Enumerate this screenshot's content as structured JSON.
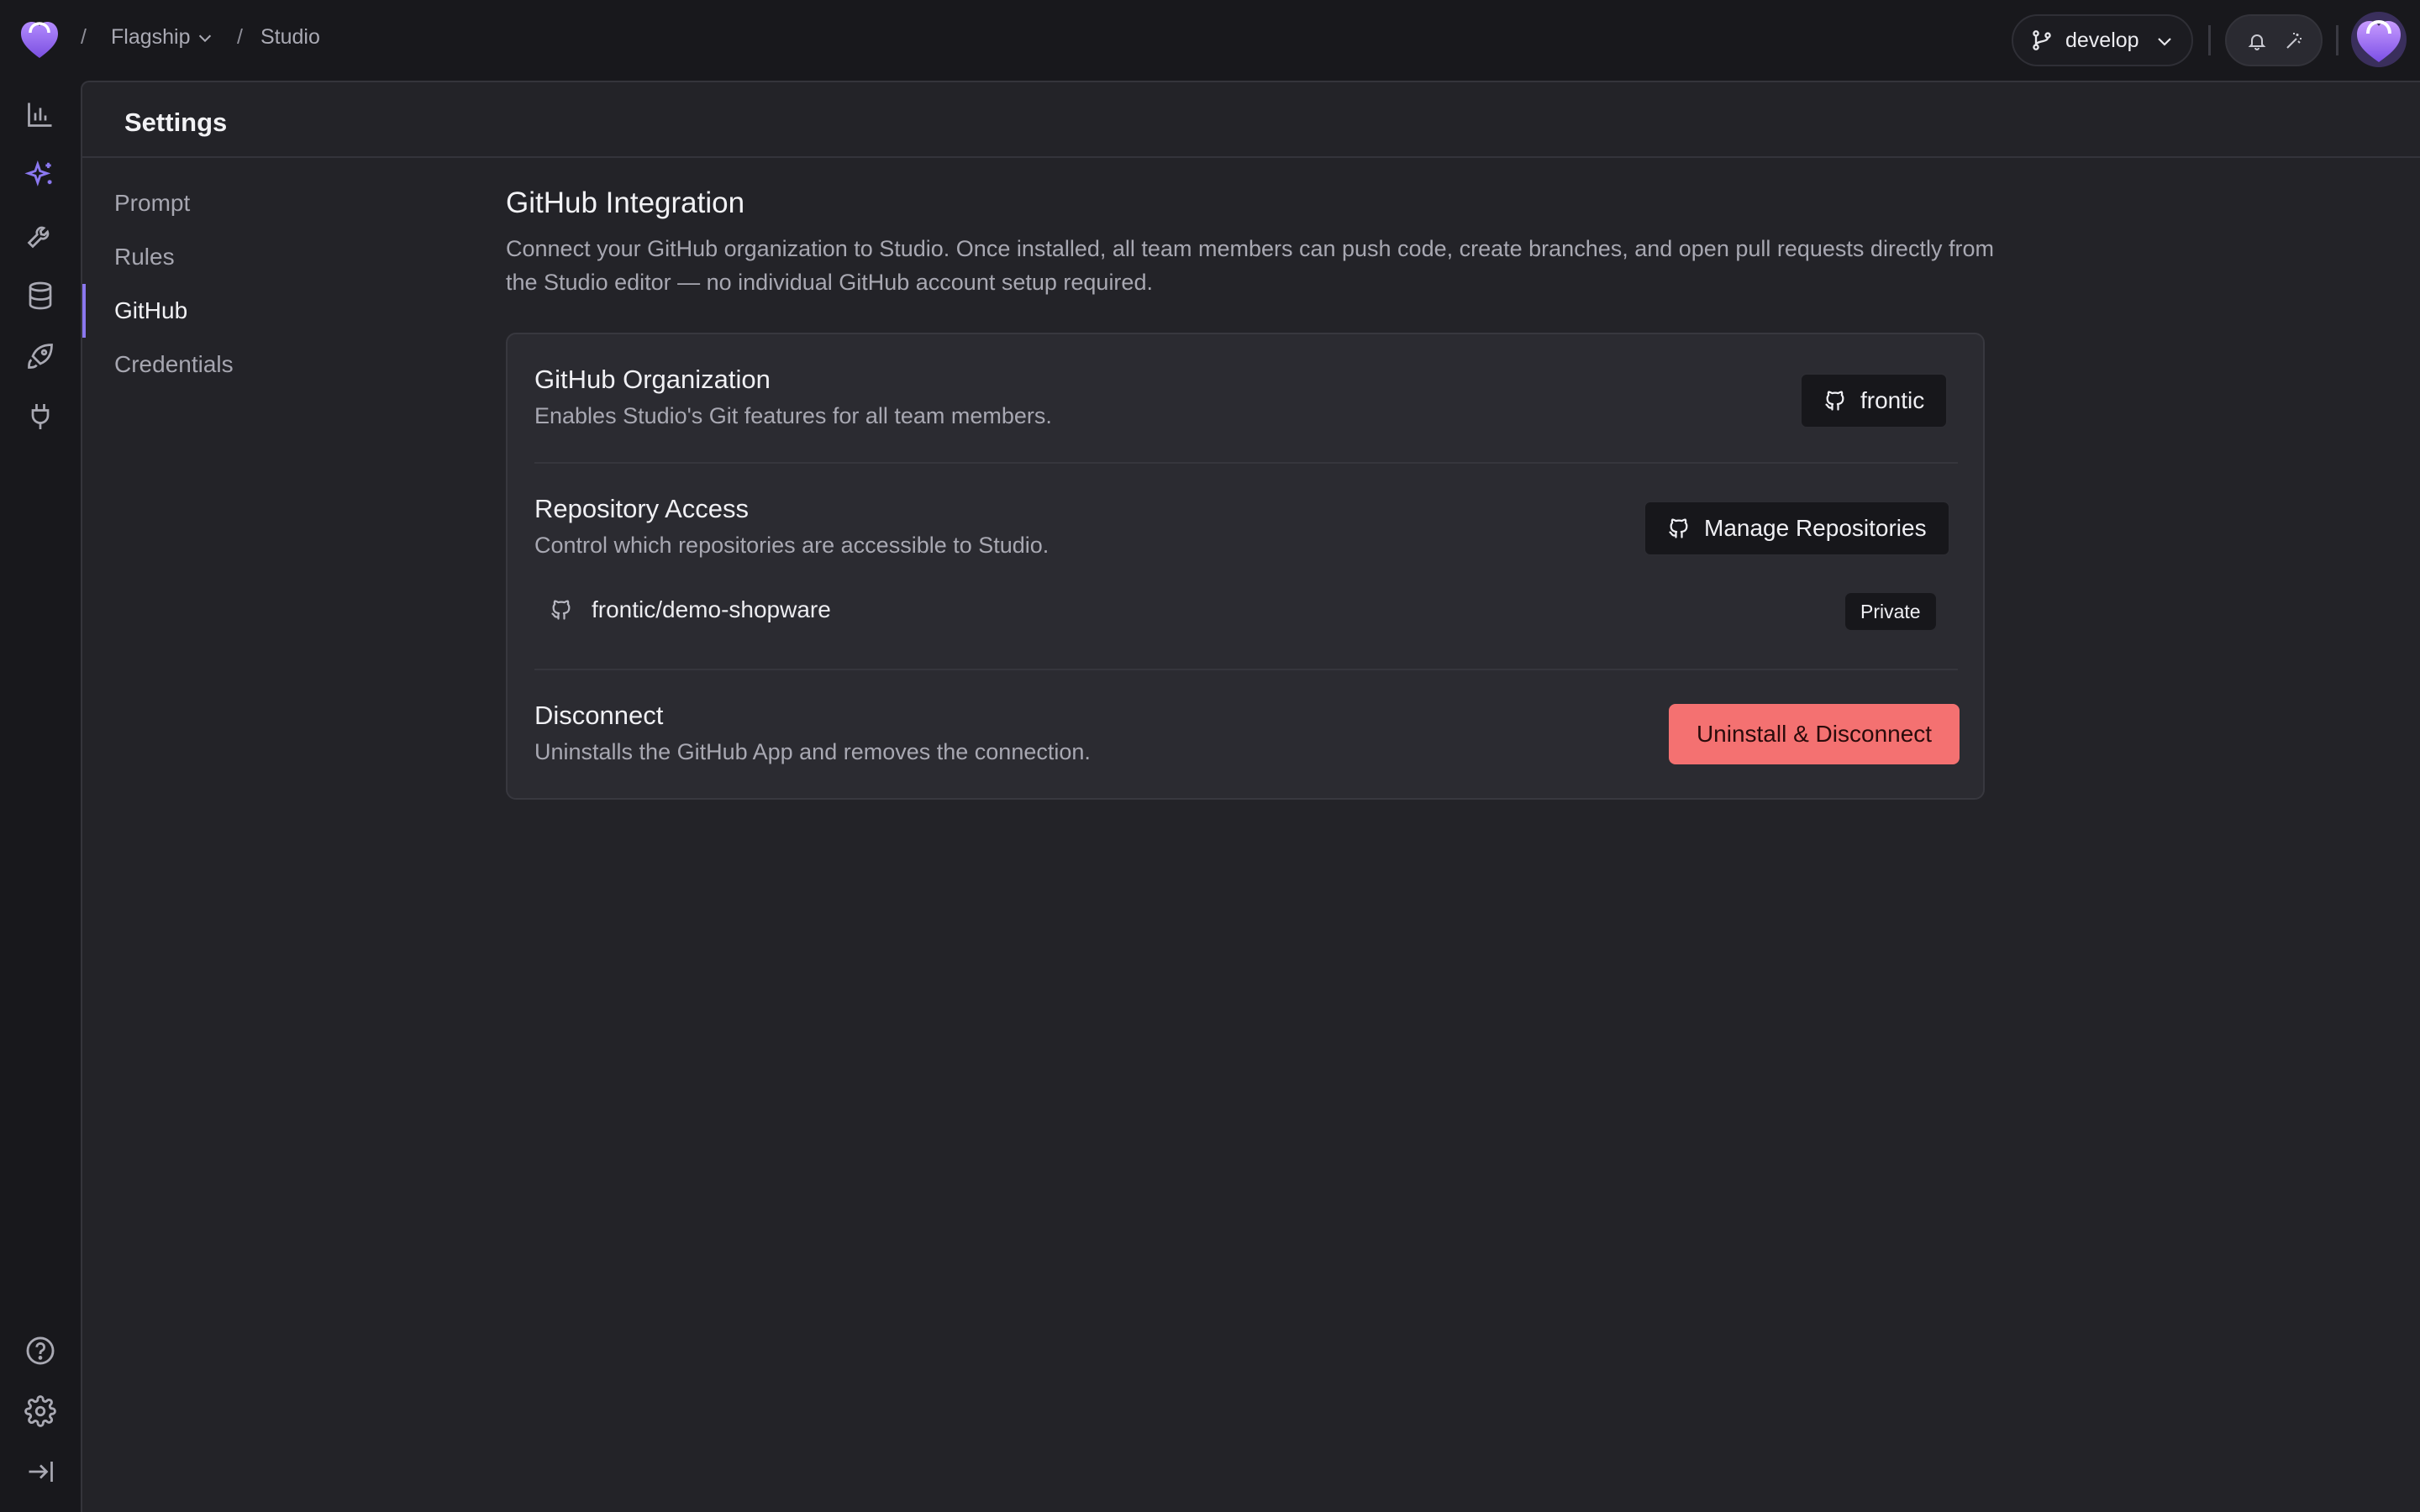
{
  "breadcrumb": {
    "separator": "/",
    "project": "Flagship",
    "page": "Studio"
  },
  "branch": {
    "name": "develop"
  },
  "colors": {
    "accent": "#8b78f0",
    "danger": "#f47171",
    "background": "#18181c",
    "panel": "#232328",
    "card": "#2b2b31"
  },
  "rail": {
    "top_icons": [
      "analytics-icon",
      "sparkles-icon",
      "wrench-icon",
      "database-icon",
      "rocket-icon",
      "plug-icon"
    ],
    "bottom_icons": [
      "help-icon",
      "gear-icon",
      "collapse-sidebar-icon"
    ],
    "active": "sparkles-icon"
  },
  "settings": {
    "title": "Settings",
    "nav": [
      {
        "label": "Prompt",
        "active": false
      },
      {
        "label": "Rules",
        "active": false
      },
      {
        "label": "GitHub",
        "active": true
      },
      {
        "label": "Credentials",
        "active": false
      }
    ]
  },
  "github": {
    "title": "GitHub Integration",
    "description": "Connect your GitHub organization to Studio. Once installed, all team members can push code, create branches, and open pull requests directly from the Studio editor — no individual GitHub account setup required.",
    "organization": {
      "title": "GitHub Organization",
      "description": "Enables Studio's Git features for all team members.",
      "button_label": "frontic"
    },
    "repository_access": {
      "title": "Repository Access",
      "description": "Control which repositories are accessible to Studio.",
      "button_label": "Manage Repositories",
      "repositories": [
        {
          "name": "frontic/demo-shopware",
          "visibility": "Private"
        }
      ]
    },
    "disconnect": {
      "title": "Disconnect",
      "description": "Uninstalls the GitHub App and removes the connection.",
      "button_label": "Uninstall & Disconnect"
    }
  }
}
